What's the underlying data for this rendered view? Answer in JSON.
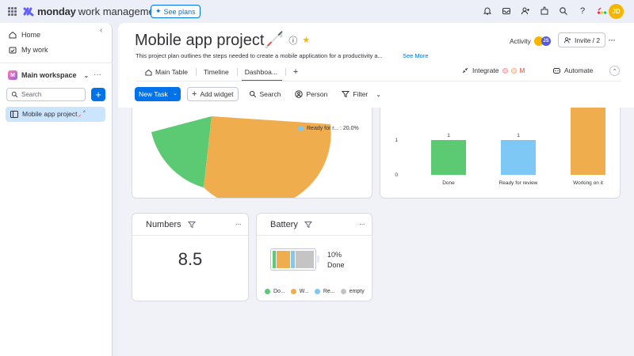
{
  "topbar": {
    "brand": "monday",
    "brand_sub": "work management",
    "see_plans": "See plans",
    "user_initials": "JD",
    "icons": [
      "bell-icon",
      "inbox-icon",
      "invite-members-icon",
      "apps-marketplace-icon",
      "search-icon",
      "help-icon",
      "monday-products-icon"
    ]
  },
  "sidebar": {
    "home": "Home",
    "my_work": "My work",
    "workspace": "Main workspace",
    "workspace_initial": "M",
    "search_placeholder": "Search",
    "board": "Mobile app project🦯"
  },
  "header": {
    "title": "Mobile app project🦯",
    "description": "This project plan outlines the steps needed to create a mobile application for a productivity a...",
    "see_more": "See More",
    "activity": "Activity",
    "activity_user": "JS",
    "invite": "Invite / 2"
  },
  "tabs": [
    {
      "label": "Main Table",
      "active": false
    },
    {
      "label": "Timeline",
      "active": false
    },
    {
      "label": "Dashboa...",
      "active": true
    }
  ],
  "integrate": "Integrate",
  "automate": "Automate",
  "toolbar": {
    "new_task": "New Task",
    "add_widget": "Add widget",
    "search": "Search",
    "person": "Person",
    "filter": "Filter"
  },
  "widgets": {
    "pie_legend": "Ready for r... : 20.0%",
    "numbers_title": "Numbers",
    "numbers_value": "8.5",
    "battery_title": "Battery",
    "battery_pct": "10%",
    "battery_label": "Done",
    "battery_legend": [
      {
        "label": "Do...",
        "color": "#5cc973"
      },
      {
        "label": "W...",
        "color": "#f0ad4e"
      },
      {
        "label": "Re...",
        "color": "#7ec8f5"
      },
      {
        "label": "empty",
        "color": "#c4c4c4"
      }
    ]
  },
  "chart_data": {
    "type": "bar",
    "categories": [
      "Done",
      "Ready for review",
      "Working on it"
    ],
    "values": [
      1,
      1,
      3
    ],
    "value_labels": [
      "1",
      "1",
      ""
    ],
    "y_ticks": [
      "0",
      "1"
    ],
    "colors": [
      "#5cc973",
      "#7ec8f5",
      "#f0ad4e"
    ]
  }
}
